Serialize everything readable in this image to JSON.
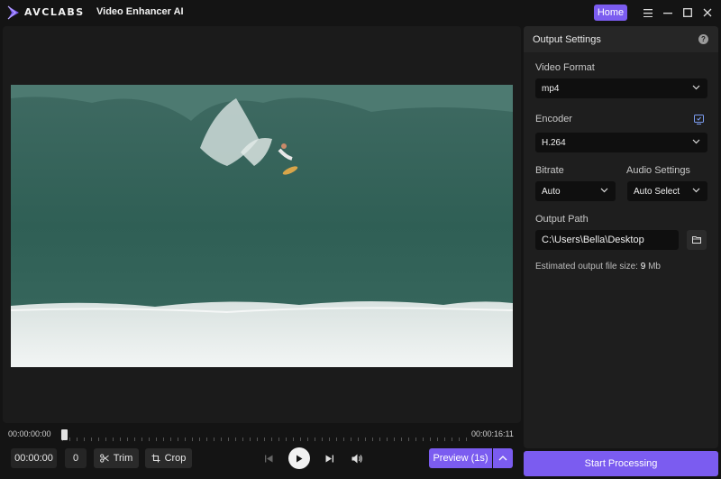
{
  "titlebar": {
    "brand": "AVCLABS",
    "app_title": "Video Enhancer AI",
    "home_label": "Home",
    "icons": [
      "menu-icon",
      "minimize-icon",
      "maximize-icon",
      "close-icon"
    ]
  },
  "timeline": {
    "start_time": "00:00:00:00",
    "end_time": "00:00:16:11",
    "playhead_fraction": 0.0
  },
  "controls": {
    "current_time": "00:00:00",
    "frame": "0",
    "trim_label": "Trim",
    "crop_label": "Crop",
    "preview_label": "Preview (1s)"
  },
  "settings": {
    "title": "Output Settings",
    "video_format": {
      "label": "Video Format",
      "value": "mp4"
    },
    "encoder": {
      "label": "Encoder",
      "value": "H.264"
    },
    "bitrate": {
      "label": "Bitrate",
      "value": "Auto"
    },
    "audio": {
      "label": "Audio Settings",
      "value": "Auto Select"
    },
    "output_path": {
      "label": "Output Path",
      "value": "C:\\Users\\Bella\\Desktop"
    },
    "estimate_prefix": "Estimated output file size:",
    "estimate_value": "9",
    "estimate_unit": "Mb",
    "start_label": "Start Processing"
  },
  "colors": {
    "accent": "#7b5cf0",
    "background": "#141414",
    "panel": "#1e1e1e"
  }
}
